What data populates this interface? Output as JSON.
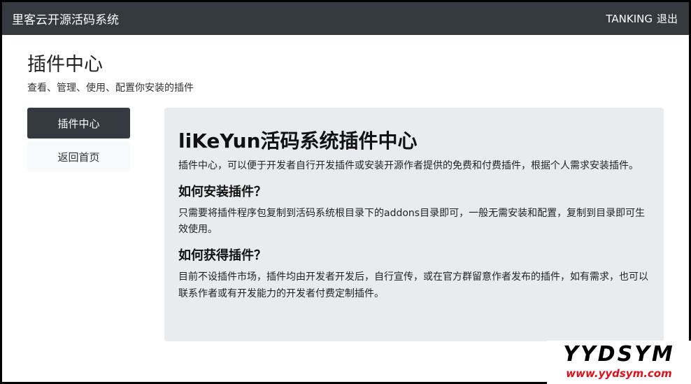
{
  "navbar": {
    "brand": "里客云开源活码系统",
    "user": "TANKING",
    "logout": "退出"
  },
  "page": {
    "title": "插件中心",
    "subtitle": "查看、管理、使用、配置你安装的插件"
  },
  "sidebar": {
    "items": [
      {
        "label": "插件中心",
        "active": true
      },
      {
        "label": "返回首页",
        "active": false
      }
    ]
  },
  "panel": {
    "heading": "liKeYun活码系统插件中心",
    "intro": "插件中心，可以便于开发者自行开发插件或安装开源作者提供的免费和付费插件，根据个人需求安装插件。",
    "sections": [
      {
        "title": "如何安装插件？",
        "body": "只需要将插件程序包复制到活码系统根目录下的addons目录即可，一般无需安装和配置，复制到目录即可生效使用。"
      },
      {
        "title": "如何获得插件？",
        "body": "目前不设插件市场，插件均由开发者开发后，自行宣传，或在官方群留意作者发布的插件，如有需求，也可以联系作者或有开发能力的开发者付费定制插件。"
      }
    ]
  },
  "watermark": {
    "name": "YYDSYM",
    "url": "www.yydsym.com"
  }
}
